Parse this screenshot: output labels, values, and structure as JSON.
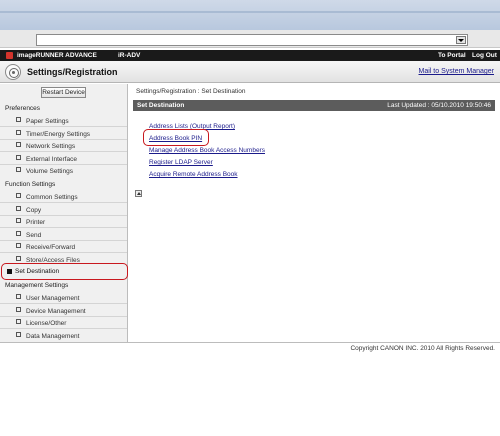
{
  "app": {
    "product": "imageRUNNER ADVANCE",
    "model": "iR-ADV",
    "to_portal": "To Portal",
    "log_out": "Log Out"
  },
  "header": {
    "title": "Settings/Registration",
    "mail_to_manager": "Mail to System Manager"
  },
  "sidebar": {
    "restart_button": "Restart Device",
    "preferences": {
      "heading": "Preferences",
      "items": [
        "Paper Settings",
        "Timer/Energy Settings",
        "Network Settings",
        "External Interface",
        "Volume Settings"
      ]
    },
    "function_settings": {
      "heading": "Function Settings",
      "items": [
        "Common Settings",
        "Copy",
        "Printer",
        "Send",
        "Receive/Forward",
        "Store/Access Files"
      ]
    },
    "set_destination": "Set Destination",
    "management_settings": {
      "heading": "Management Settings",
      "items": [
        "User Management",
        "Device Management",
        "License/Other",
        "Data Management"
      ]
    }
  },
  "main": {
    "breadcrumb": "Settings/Registration : Set Destination",
    "section_title": "Set Destination",
    "last_updated": "Last Updated : 05/10.2010 19:50:46",
    "links": [
      "Address Lists (Output Report)",
      "Address Book PIN",
      "Manage Address Book Access Numbers",
      "Register LDAP Server",
      "Acquire Remote Address Book"
    ]
  },
  "footer": {
    "copyright": "Copyright CANON INC. 2010 All Rights Reserved."
  },
  "colors": {
    "highlight_ring": "#c8181e",
    "header_black": "#1a1a1a",
    "section_bar": "#5c5c5c",
    "link": "#1a1a8a"
  }
}
